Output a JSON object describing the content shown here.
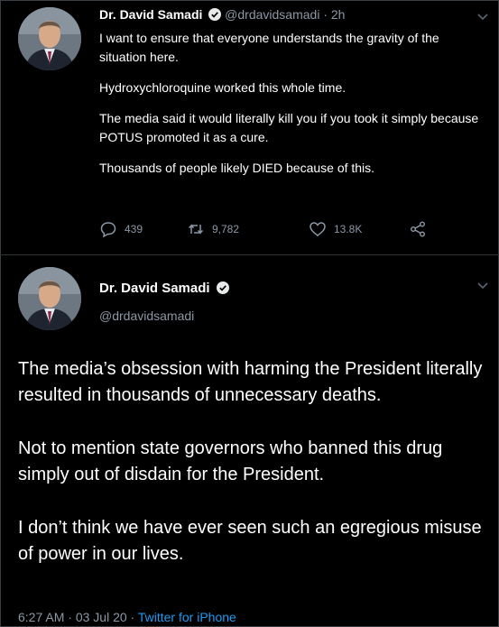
{
  "tweet1": {
    "author_name": "Dr. David Samadi",
    "handle": "@drdavidsamadi",
    "separator": "·",
    "time": "2h",
    "paragraphs": [
      "I want to ensure that everyone understands the gravity of the situation here.",
      "Hydroxychloroquine worked this whole time.",
      "The media said it would literally kill you if you took it simply because POTUS promoted it as a cure.",
      "Thousands of people likely DIED because of this."
    ],
    "replies": "439",
    "retweets": "9,782",
    "likes": "13.8K"
  },
  "tweet2": {
    "author_name": "Dr. David Samadi",
    "handle": "@drdavidsamadi",
    "paragraphs": [
      "The media’s obsession with harming the President literally resulted in thousands of unnecessary deaths.",
      "Not to mention state governors who banned this drug simply out of disdain for the President.",
      "I don’t think we have ever seen such an egregious misuse of power in our lives."
    ],
    "time": "6:27 AM",
    "separator1": "·",
    "date": "03 Jul 20",
    "separator2": "·",
    "source": "Twitter for iPhone"
  },
  "icons": {
    "verified": "verified-badge-icon",
    "chevron": "chevron-down-icon",
    "reply": "reply-icon",
    "retweet": "retweet-icon",
    "like": "heart-icon",
    "share": "share-icon"
  },
  "colors": {
    "background": "#000000",
    "text": "#ffffff",
    "muted": "#8b98a5",
    "link": "#1d9bf0"
  }
}
